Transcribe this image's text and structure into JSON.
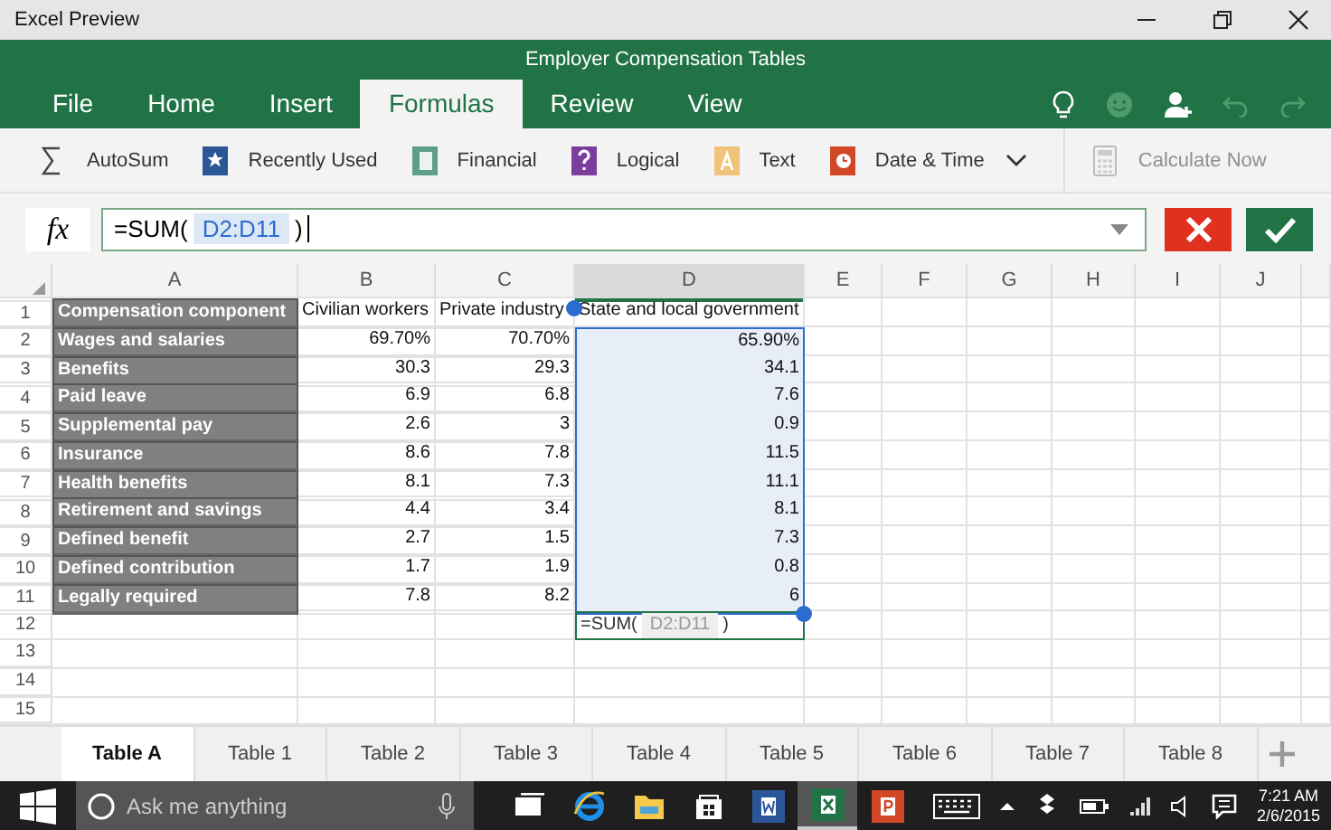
{
  "window": {
    "title": "Excel Preview"
  },
  "document_title": "Employer Compensation Tables",
  "ribbon_tabs": [
    {
      "label": "File",
      "selected": false
    },
    {
      "label": "Home",
      "selected": false
    },
    {
      "label": "Insert",
      "selected": false
    },
    {
      "label": "Formulas",
      "selected": true
    },
    {
      "label": "Review",
      "selected": false
    },
    {
      "label": "View",
      "selected": false
    }
  ],
  "commands": [
    {
      "kind": "autosum",
      "label": "AutoSum",
      "disabled": false
    },
    {
      "kind": "recent",
      "label": "Recently Used",
      "disabled": false
    },
    {
      "kind": "financial",
      "label": "Financial",
      "disabled": false
    },
    {
      "kind": "logical",
      "label": "Logical",
      "disabled": false
    },
    {
      "kind": "text",
      "label": "Text",
      "disabled": false
    },
    {
      "kind": "datetime",
      "label": "Date & Time",
      "disabled": false
    },
    {
      "kind": "calculate",
      "label": "Calculate Now",
      "disabled": true
    }
  ],
  "formula_bar": {
    "function_label": "fx",
    "prefix": "=SUM(",
    "range": "D2:D11",
    "suffix": ")"
  },
  "sheet": {
    "columns": [
      {
        "label": "A",
        "selected": false
      },
      {
        "label": "B",
        "selected": false
      },
      {
        "label": "C",
        "selected": false
      },
      {
        "label": "D",
        "selected": true
      },
      {
        "label": "E",
        "selected": false
      },
      {
        "label": "F",
        "selected": false
      },
      {
        "label": "G",
        "selected": false
      },
      {
        "label": "H",
        "selected": false
      },
      {
        "label": "I",
        "selected": false
      },
      {
        "label": "J",
        "selected": false
      }
    ],
    "rows": [
      {
        "number": "1",
        "selected": false,
        "cells": [
          "Compensation component",
          "Civilian workers",
          "Private industry",
          "State and local government"
        ]
      },
      {
        "number": "2",
        "selected": true,
        "cells": [
          "Wages and salaries",
          "69.70%",
          "70.70%",
          "65.90%"
        ]
      },
      {
        "number": "3",
        "selected": true,
        "cells": [
          "Benefits",
          "30.3",
          "29.3",
          "34.1"
        ]
      },
      {
        "number": "4",
        "selected": true,
        "cells": [
          "Paid leave",
          "6.9",
          "6.8",
          "7.6"
        ]
      },
      {
        "number": "5",
        "selected": true,
        "cells": [
          "Supplemental pay",
          "2.6",
          "3",
          "0.9"
        ]
      },
      {
        "number": "6",
        "selected": true,
        "cells": [
          "Insurance",
          "8.6",
          "7.8",
          "11.5"
        ]
      },
      {
        "number": "7",
        "selected": true,
        "cells": [
          "Health benefits",
          "8.1",
          "7.3",
          "11.1"
        ]
      },
      {
        "number": "8",
        "selected": true,
        "cells": [
          "Retirement and savings",
          "4.4",
          "3.4",
          "8.1"
        ]
      },
      {
        "number": "9",
        "selected": true,
        "cells": [
          "Defined benefit",
          "2.7",
          "1.5",
          "7.3"
        ]
      },
      {
        "number": "10",
        "selected": true,
        "cells": [
          "Defined contribution",
          "1.7",
          "1.9",
          "0.8"
        ]
      },
      {
        "number": "11",
        "selected": true,
        "cells": [
          "Legally required",
          "7.8",
          "8.2",
          "6"
        ]
      },
      {
        "number": "12",
        "selected": false,
        "cells": [],
        "formula_cell": {
          "prefix": "=SUM(",
          "range": "D2:D11",
          "suffix": ")"
        }
      },
      {
        "number": "13",
        "selected": false,
        "cells": []
      },
      {
        "number": "14",
        "selected": false,
        "cells": []
      },
      {
        "number": "15",
        "selected": false,
        "cells": []
      }
    ]
  },
  "sheet_tabs": [
    {
      "label": "Table A",
      "selected": true
    },
    {
      "label": "Table 1",
      "selected": false
    },
    {
      "label": "Table 2",
      "selected": false
    },
    {
      "label": "Table 3",
      "selected": false
    },
    {
      "label": "Table 4",
      "selected": false
    },
    {
      "label": "Table 5",
      "selected": false
    },
    {
      "label": "Table 6",
      "selected": false
    },
    {
      "label": "Table 7",
      "selected": false
    },
    {
      "label": "Table 8",
      "selected": false
    }
  ],
  "taskbar": {
    "search_placeholder": "Ask me anything",
    "apps": [
      {
        "kind": "taskview",
        "selected": false
      },
      {
        "kind": "browser",
        "selected": false
      },
      {
        "kind": "folder",
        "selected": false
      },
      {
        "kind": "store",
        "selected": false
      },
      {
        "kind": "word",
        "selected": false
      },
      {
        "kind": "excel",
        "selected": true
      },
      {
        "kind": "powerpoint",
        "selected": false
      }
    ],
    "time": "7:21 AM",
    "date": "2/6/2015"
  }
}
